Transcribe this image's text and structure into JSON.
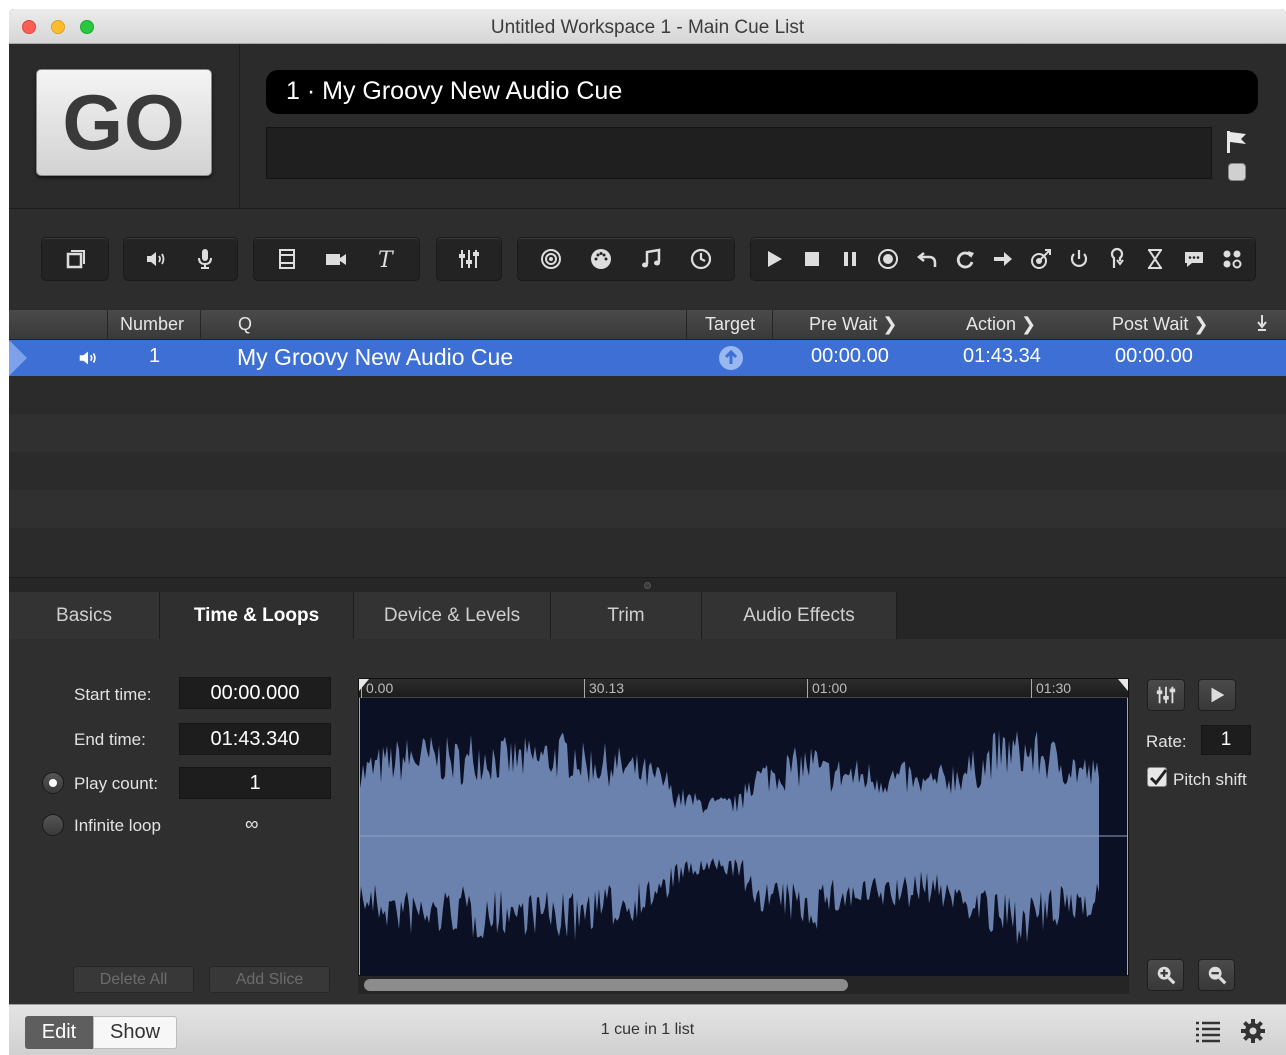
{
  "window": {
    "title": "Untitled Workspace 1 - Main Cue List"
  },
  "go_button": {
    "label": "GO"
  },
  "cue_display": {
    "text": "1 · My Groovy New Audio Cue",
    "notes": ""
  },
  "toolbar": {
    "groups": [
      [
        "group-cue-icon"
      ],
      [
        "speaker-icon",
        "microphone-icon"
      ],
      [
        "film-icon",
        "camera-icon",
        "text-icon"
      ],
      [
        "fader-icon"
      ],
      [
        "target-icon",
        "midi-icon",
        "music-note-icon",
        "clock-icon"
      ],
      [
        "play-icon",
        "stop-icon",
        "pause-icon",
        "record-icon",
        "undo-icon",
        "redo-icon",
        "arrow-right-icon",
        "target-arrow-icon",
        "power-icon",
        "devamp-icon",
        "hourglass-icon",
        "speech-icon",
        "grid-dots-icon"
      ]
    ]
  },
  "table": {
    "headers": {
      "number": "Number",
      "q": "Q",
      "target": "Target",
      "pre_wait": "Pre Wait",
      "action": "Action",
      "post_wait": "Post Wait"
    },
    "rows": [
      {
        "type_icon": "speaker-icon",
        "number": "1",
        "q": "My Groovy New Audio Cue",
        "target_icon": "arrow-up-circle-icon",
        "pre_wait": "00:00.00",
        "action": "01:43.34",
        "post_wait": "00:00.00"
      }
    ]
  },
  "tabs": [
    {
      "label": "Basics",
      "active": false
    },
    {
      "label": "Time & Loops",
      "active": true
    },
    {
      "label": "Device & Levels",
      "active": false
    },
    {
      "label": "Trim",
      "active": false
    },
    {
      "label": "Audio Effects",
      "active": false
    }
  ],
  "time_loops": {
    "start_label": "Start time:",
    "start_value": "00:00.000",
    "end_label": "End time:",
    "end_value": "01:43.340",
    "play_count_label": "Play count:",
    "play_count_value": "1",
    "infinite_label": "Infinite loop",
    "infinite_symbol": "∞",
    "delete_all": "Delete All",
    "add_slice": "Add Slice",
    "rate_label": "Rate:",
    "rate_value": "1",
    "pitch_label": "Pitch shift",
    "pitch_checked": true,
    "ruler": [
      "0.00",
      "30.13",
      "01:00",
      "01:30"
    ]
  },
  "bottom": {
    "edit": "Edit",
    "show": "Show",
    "status": "1 cue in 1 list"
  },
  "colors": {
    "accent": "#3d6fd4",
    "waveform_fill": "#6a82ad",
    "waveform_bg": "#0c1024"
  }
}
